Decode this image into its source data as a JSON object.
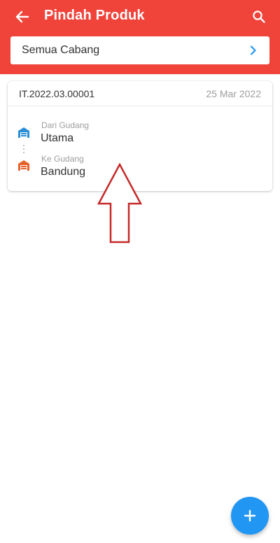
{
  "header": {
    "title": "Pindah Produk",
    "back_icon": "arrow-left-icon",
    "search_icon": "search-icon",
    "background_color": "#f0433a"
  },
  "branch_filter": {
    "value": "Semua Cabang",
    "icon": "chevron-right-icon",
    "icon_color": "#2196f3"
  },
  "transfers": [
    {
      "code": "IT.2022.03.00001",
      "date": "25 Mar 2022",
      "from_label": "Dari Gudang",
      "from_value": "Utama",
      "from_icon_color": "#2b8fd6",
      "to_label": "Ke Gudang",
      "to_value": "Bandung",
      "to_icon_color": "#e8632b"
    }
  ],
  "fab": {
    "icon": "plus-icon",
    "color": "#2196f3"
  },
  "annotation": {
    "icon": "up-arrow-annotation-icon",
    "color": "#c62828"
  }
}
